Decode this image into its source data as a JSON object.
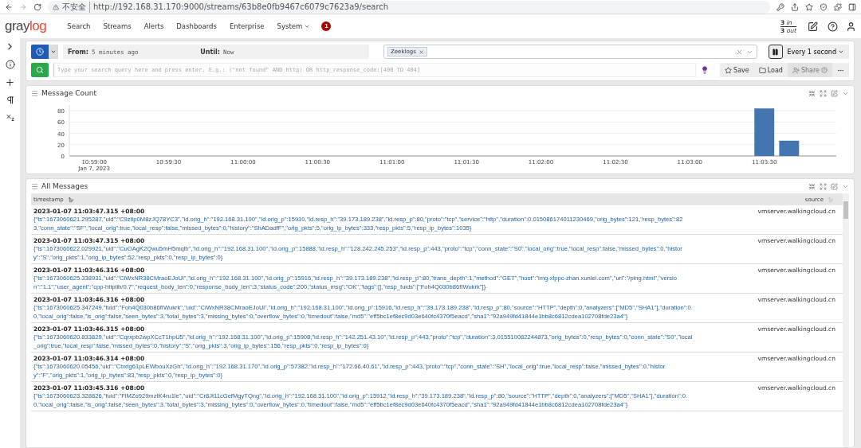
{
  "browser": {
    "security": "不安全",
    "url": "http://192.168.31.170:9000/streams/63b8e0fb9467c6079c7623a9/search"
  },
  "nav": {
    "logo": [
      "gray",
      "log"
    ],
    "items": [
      {
        "label": "Search",
        "dropdown": false
      },
      {
        "label": "Streams",
        "dropdown": false
      },
      {
        "label": "Alerts",
        "dropdown": false
      },
      {
        "label": "Dashboards",
        "dropdown": false
      },
      {
        "label": "Enterprise",
        "dropdown": false
      },
      {
        "label": "System",
        "dropdown": true
      }
    ],
    "notification_count": "1",
    "throughput": {
      "in_count": "3",
      "in_label": "in",
      "out_count": "3",
      "out_label": "out"
    }
  },
  "search": {
    "from_label": "From:",
    "from_value": "5 minutes ago",
    "until_label": "Until:",
    "until_value": "Now",
    "streams": [
      "Zeeklogs"
    ],
    "refresh": "Every 1 second",
    "query_placeholder": "Type your search query here and press enter. E.g.: (\"not found\" AND http) OR http_response_code:[400 TO 404]",
    "actions": [
      {
        "label": "Save",
        "disabled": false
      },
      {
        "label": "Load",
        "disabled": false
      },
      {
        "label": "Share",
        "disabled": true
      }
    ]
  },
  "message_count": {
    "title": "Message Count",
    "date_label": "Jan 7, 2023",
    "chart_data": {
      "type": "bar",
      "categories": [
        "10:59:00",
        null,
        null,
        "10:59:30",
        null,
        null,
        "11:00:00",
        null,
        null,
        "11:00:30",
        null,
        null,
        "11:01:00",
        null,
        null,
        "11:01:30",
        null,
        null,
        "11:02:00",
        null,
        null,
        "11:02:30",
        null,
        null,
        "11:03:00",
        null,
        null,
        "11:03:30",
        null
      ],
      "series": [
        {
          "color": "#4375b0",
          "values": [
            null,
            null,
            null,
            null,
            null,
            null,
            null,
            null,
            null,
            null,
            null,
            null,
            null,
            null,
            null,
            null,
            null,
            null,
            null,
            null,
            null,
            null,
            null,
            null,
            null,
            null,
            null,
            84,
            27
          ]
        }
      ],
      "grid": true,
      "ylim": [
        0,
        90
      ],
      "yticks": [
        0,
        20,
        40,
        60,
        80
      ]
    }
  },
  "all_messages": {
    "title": "All Messages",
    "columns": [
      "timestamp",
      "source"
    ],
    "rows": [
      {
        "timestamp": "2023-01-07 11:03:47.315 +08:00",
        "source": "vmserver.walkingcloud.cn",
        "message": [
          "{\"ts\":1673060621.295287,\"uid\":\"C9zIip0M8zJQ78YC3\",\"id.orig_h\":\"192.168.31.100\",\"id.orig_p\":15910,\"id.resp_h\":\"39.173.189.238\",\"id.resp_p\":80,\"proto\":\"tcp\",\"service\":\"http\",\"duration\":0.015086174011230469,\"orig_bytes\":121,\"resp_bytes\":82",
          "3,\"conn_state\":\"SF\",\"local_orig\":true,\"local_resp\":false,\"missed_bytes\":0,\"history\":\"ShADadfF\",\"orig_pkts\":5,\"orig_ip_bytes\":333,\"resp_pkts\":5,\"resp_ip_bytes\":1035}"
        ]
      },
      {
        "timestamp": "2023-01-07 11:03:47.315 +08:00",
        "source": "vmserver.walkingcloud.cn",
        "message": [
          "{\"ts\":1673060622.029921,\"uid\":\"CuOAgK2Qwu5mH5mqlb\",\"id.orig_h\":\"192.168.31.100\",\"id.orig_p\":15888,\"id.resp_h\":\"128.242.245.253\",\"id.resp_p\":443,\"proto\":\"tcp\",\"conn_state\":\"S0\",\"local_orig\":true,\"local_resp\":false,\"missed_bytes\":0,\"histor",
          "y\":\"S\",\"orig_pkts\":1,\"orig_ip_bytes\":52,\"resp_pkts\":0,\"resp_ip_bytes\":0}"
        ]
      },
      {
        "timestamp": "2023-01-07 11:03:46.316 +08:00",
        "source": "vmserver.walkingcloud.cn",
        "message": [
          "{\"ts\":1673060625.338931,\"uid\":\"CiWxNR38CMraoEJoUl\",\"id.orig_h\":\"192.168.31.100\",\"id.orig_p\":15916,\"id.resp_h\":\"39.173.189.238\",\"id.resp_p\":80,\"trans_depth\":1,\"method\":\"GET\",\"host\":\"img-xlppc-zhan.xunlei.com\",\"uri\":\"/ping.html\",\"versio",
          "n\":\"1.1\",\"user_agent\":\"cpp-httplib/0.7\",\"request_body_len\":0,\"response_body_len\":3,\"status_code\":200,\"status_msg\":\"OK\",\"tags\":[],\"resp_fuids\":[\"Foh4Q030b86fIWukrk\"]}"
        ]
      },
      {
        "timestamp": "2023-01-07 11:03:46.316 +08:00",
        "source": "vmserver.walkingcloud.cn",
        "message": [
          "{\"ts\":1673060625.347249,\"fuid\":\"Foh4Q030b86fIWukrk\",\"uid\":\"CiWxNR38CMraoEJoUl\",\"id.orig_h\":\"192.168.31.100\",\"id.orig_p\":15916,\"id.resp_h\":\"39.173.189.238\",\"id.resp_p\":80,\"source\":\"HTTP\",\"depth\":0,\"analyzers\":[\"MD5\",\"SHA1\"],\"duration\":0.",
          "0,\"local_orig\":false,\"is_orig\":false,\"seen_bytes\":3,\"total_bytes\":3,\"missing_bytes\":0,\"overflow_bytes\":0,\"timedout\":false,\"md5\":\"eff5bc1ef8ec9d03e640fc4370f5eacd\",\"sha1\":\"92a949fd41844e1bb8c6812cdea102708fde23a4\"}"
        ]
      },
      {
        "timestamp": "2023-01-07 11:03:46.315 +08:00",
        "source": "vmserver.walkingcloud.cn",
        "message": [
          "{\"ts\":1673060620.833829,\"uid\":\"Cqrxpb2wpXCcT1hpU5\",\"id.orig_h\":\"192.168.31.100\",\"id.orig_p\":15908,\"id.resp_h\":\"142.251.43.10\",\"id.resp_p\":443,\"proto\":\"tcp\",\"duration\":3.015510082244873,\"orig_bytes\":0,\"resp_bytes\":0,\"conn_state\":\"S0\",\"local",
          "_orig\":true,\"local_resp\":false,\"missed_bytes\":0,\"history\":\"S\",\"orig_pkts\":3,\"orig_ip_bytes\":156,\"resp_pkts\":0,\"resp_ip_bytes\":0}"
        ]
      },
      {
        "timestamp": "2023-01-07 11:03:46.314 +08:00",
        "source": "vmserver.walkingcloud.cn",
        "message": [
          "{\"ts\":1673060620.05456,\"uid\":\"Cbxtg61pLEWbouXzGh\",\"id.orig_h\":\"192.168.31.170\",\"id.orig_p\":57382,\"id.resp_h\":\"172.66.40.61\",\"id.resp_p\":443,\"proto\":\"tcp\",\"conn_state\":\"SH\",\"local_orig\":true,\"local_resp\":false,\"missed_bytes\":0,\"histor",
          "y\":\"F\",\"orig_pkts\":1,\"orig_ip_bytes\":83,\"resp_pkts\":0,\"resp_ip_bytes\":0}"
        ]
      },
      {
        "timestamp": "2023-01-07 11:03:45.316 +08:00",
        "source": "vmserver.walkingcloud.cn",
        "message": [
          "{\"ts\":1673060623.328826,\"fuid\":\"FlMZo929mztK4ru1le\",\"uid\":\"Cr8Jt11cGefMgyTQng\",\"id.orig_h\":\"192.168.31.100\",\"id.orig_p\":15912,\"id.resp_h\":\"39.173.189.238\",\"id.resp_p\":80,\"source\":\"HTTP\",\"depth\":0,\"analyzers\":[\"MD5\",\"SHA1\"],\"duration\":0.",
          "0,\"local_orig\":false,\"is_orig\":false,\"seen_bytes\":3,\"total_bytes\":3,\"missing_bytes\":0,\"overflow_bytes\":0,\"timedout\":false,\"md5\":\"eff5bc1ef8ec9d03e640fc4370f5eacd\",\"sha1\":\"92a949fd41844e1bb8c6812cdea102708fde23a4\"}"
        ]
      }
    ]
  }
}
